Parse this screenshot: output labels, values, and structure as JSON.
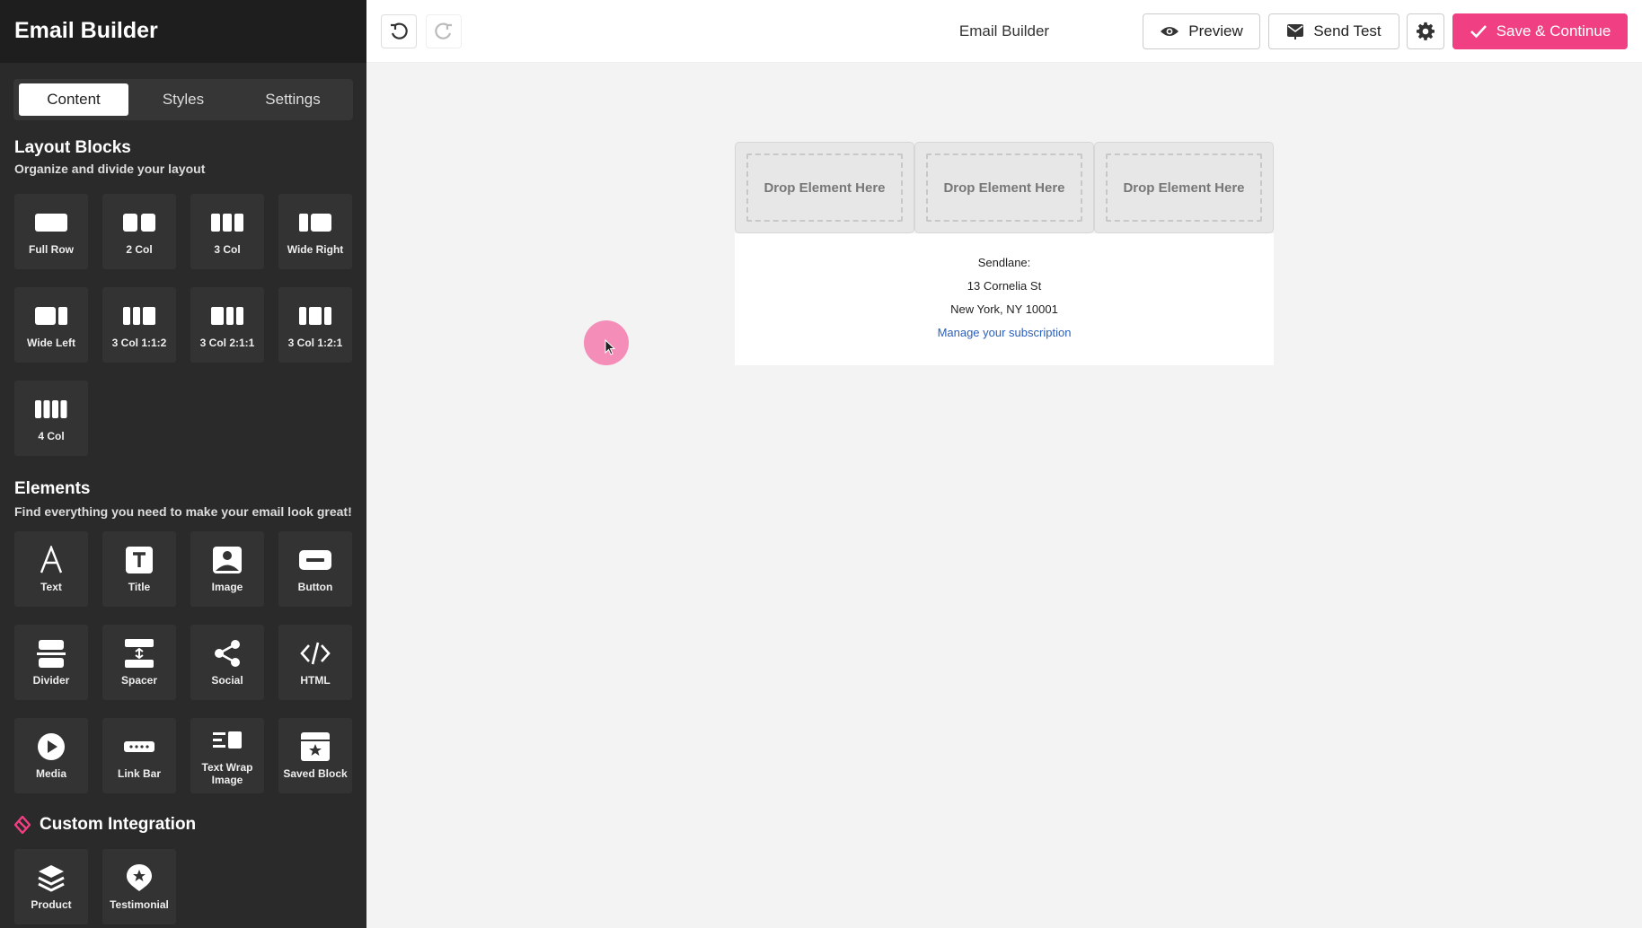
{
  "sidebar": {
    "title": "Email Builder",
    "tabs": [
      "Content",
      "Styles",
      "Settings"
    ],
    "layout": {
      "title": "Layout Blocks",
      "subtitle": "Organize and divide your layout",
      "items": [
        "Full Row",
        "2 Col",
        "3 Col",
        "Wide Right",
        "Wide Left",
        "3 Col 1:1:2",
        "3 Col 2:1:1",
        "3 Col 1:2:1",
        "4 Col"
      ]
    },
    "elements": {
      "title": "Elements",
      "subtitle": "Find everything you need to make your email look great!",
      "items": [
        "Text",
        "Title",
        "Image",
        "Button",
        "Divider",
        "Spacer",
        "Social",
        "HTML",
        "Media",
        "Link Bar",
        "Text Wrap Image",
        "Saved Block"
      ]
    },
    "custom": {
      "title": "Custom Integration",
      "items": [
        "Product",
        "Testimonial"
      ]
    }
  },
  "topbar": {
    "title": "Email Builder",
    "preview": "Preview",
    "send_test": "Send Test",
    "save": "Save & Continue"
  },
  "canvas": {
    "drop_labels": [
      "Drop Element Here",
      "Drop Element Here",
      "Drop Element Here"
    ],
    "footer": {
      "company": "Sendlane:",
      "street": "13 Cornelia St",
      "city": "New York, NY 10001",
      "manage_link": "Manage your subscription"
    }
  },
  "colors": {
    "accent": "#f03f82",
    "sidebar_bg": "#2a2a2a",
    "link": "#2b5fb8"
  }
}
